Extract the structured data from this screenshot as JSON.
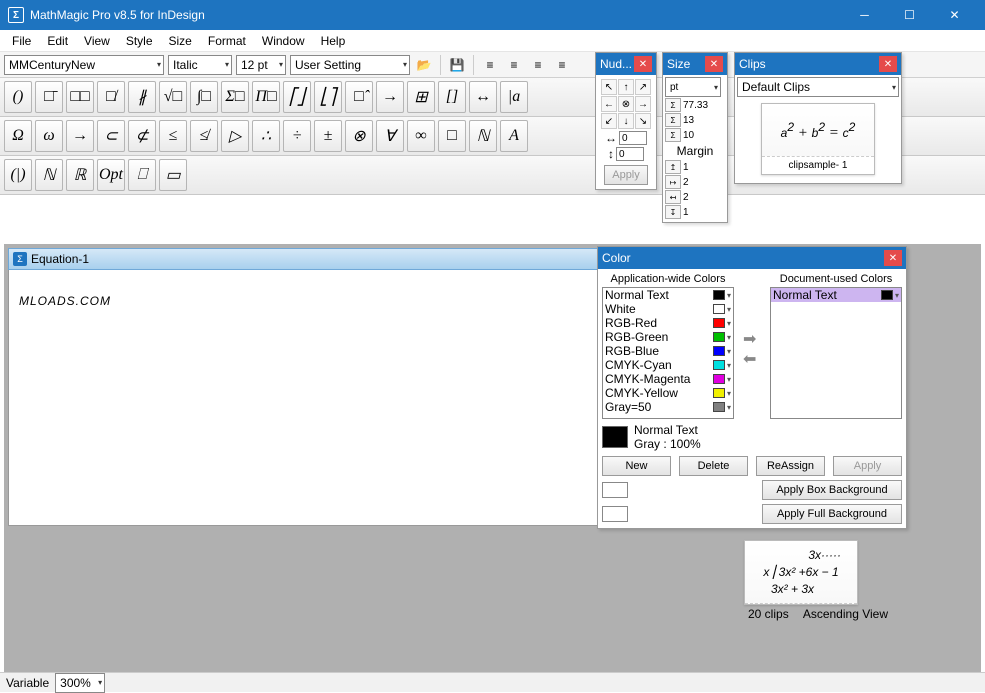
{
  "app": {
    "title": "MathMagic Pro v8.5 for InDesign",
    "icon": "Σ"
  },
  "menus": [
    "File",
    "Edit",
    "View",
    "Style",
    "Size",
    "Format",
    "Window",
    "Help"
  ],
  "toolbar": {
    "font": "MMCenturyNew",
    "style": "Italic",
    "size": "12 pt",
    "preset": "User Setting"
  },
  "palette1_labels": [
    "()",
    "□̄",
    "□□",
    "□̸",
    "∦",
    "√□",
    "∫□",
    "Σ□",
    "Π□",
    "⎡⎦",
    "⎣⎤",
    "□̂",
    "→",
    "⊞",
    "[]",
    "↔",
    "|a"
  ],
  "palette2_labels": [
    "Ω",
    "ω",
    "→",
    "⊂",
    "⊄",
    "≤",
    "≰",
    "▷",
    "∴",
    "÷",
    "±",
    "⊗",
    "∀",
    "∞",
    "□",
    "ℕ",
    "A"
  ],
  "palette3_labels": [
    "(|)",
    "ℕ",
    "ℝ",
    "Opt",
    "⎕",
    "▭"
  ],
  "doc": {
    "title": "Equation-1",
    "content": "MLOADS.COM"
  },
  "nudge": {
    "title": "Nud...",
    "h": "0",
    "v": "0",
    "apply": "Apply"
  },
  "size_panel": {
    "title": "Size",
    "unit": "pt",
    "rows": [
      {
        "ico": "Σ",
        "v": "77.33"
      },
      {
        "ico": "Σ",
        "v": "13"
      },
      {
        "ico": "Σ",
        "v": "10"
      }
    ],
    "margin_label": "Margin",
    "margins": [
      {
        "ico": "↥",
        "v": "1"
      },
      {
        "ico": "↦",
        "v": "2"
      },
      {
        "ico": "↤",
        "v": "2"
      },
      {
        "ico": "↧",
        "v": "1"
      }
    ]
  },
  "clips": {
    "title": "Clips",
    "dd": "Default Clips",
    "tile1": {
      "eq": "a² + b² = c²",
      "cap": "clipsample- 1"
    },
    "tile2_lines": [
      "3x·····",
      "x⎟ 3x² +6x − 1",
      "3x² + 3x"
    ],
    "foot_left": "20 clips",
    "foot_right": "Ascending View"
  },
  "color": {
    "title": "Color",
    "left_title": "Application-wide Colors",
    "right_title": "Document-used Colors",
    "left": [
      {
        "name": "Normal Text",
        "hex": "#000000"
      },
      {
        "name": "White",
        "hex": "#ffffff"
      },
      {
        "name": "RGB-Red",
        "hex": "#ff0000"
      },
      {
        "name": "RGB-Green",
        "hex": "#00c000"
      },
      {
        "name": "RGB-Blue",
        "hex": "#0000ff"
      },
      {
        "name": "CMYK-Cyan",
        "hex": "#00e0e0"
      },
      {
        "name": "CMYK-Magenta",
        "hex": "#e000e0"
      },
      {
        "name": "CMYK-Yellow",
        "hex": "#f0f000"
      },
      {
        "name": "Gray=50",
        "hex": "#808080"
      }
    ],
    "right": [
      {
        "name": "Normal Text",
        "hex": "#000000"
      }
    ],
    "current_name": "Normal Text",
    "current_desc": "Gray :  100%",
    "buttons": {
      "new": "New",
      "delete": "Delete",
      "reassign": "ReAssign",
      "apply": "Apply"
    },
    "apply_box": "Apply Box Background",
    "apply_full": "Apply Full Background"
  },
  "status": {
    "mode": "Variable",
    "zoom": "300%"
  }
}
